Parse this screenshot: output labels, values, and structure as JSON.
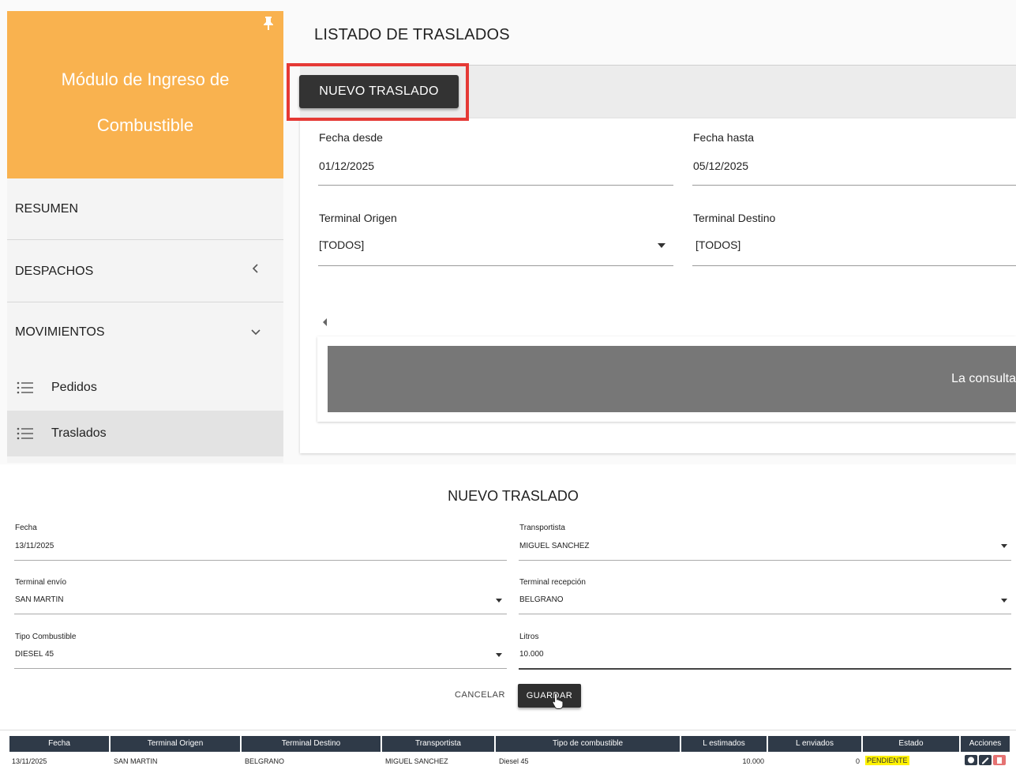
{
  "sidebar": {
    "app_title": "Módulo de Ingreso de Combustible",
    "items": [
      {
        "label": "RESUMEN"
      },
      {
        "label": "DESPACHOS"
      },
      {
        "label": "MOVIMIENTOS"
      }
    ],
    "sub_items": [
      {
        "label": "Pedidos"
      },
      {
        "label": "Traslados"
      }
    ]
  },
  "list": {
    "title": "LISTADO DE TRASLADOS",
    "new_button": "NUEVO TRASLADO",
    "filters": {
      "date_from_label": "Fecha desde",
      "date_from_value": "01/12/2025",
      "date_to_label": "Fecha hasta",
      "date_to_value": "05/12/2025",
      "origin_label": "Terminal Origen",
      "origin_value": "[TODOS]",
      "destination_label": "Terminal Destino",
      "destination_value": "[TODOS]"
    },
    "result_message": "La consulta"
  },
  "form": {
    "title": "NUEVO TRASLADO",
    "fields": {
      "date_label": "Fecha",
      "date_value": "13/11/2025",
      "carrier_label": "Transportista",
      "carrier_value": "MIGUEL SANCHEZ",
      "send_terminal_label": "Terminal envío",
      "send_terminal_value": "SAN MARTIN",
      "receive_terminal_label": "Terminal recepción",
      "receive_terminal_value": "BELGRANO",
      "fuel_type_label": "Tipo Combustible",
      "fuel_type_value": "DIESEL 45",
      "liters_label": "Litros",
      "liters_value": "10.000"
    },
    "cancel_label": "CANCELAR",
    "save_label": "GUARDAR"
  },
  "table": {
    "headers": [
      "Fecha",
      "Terminal Origen",
      "Terminal Destino",
      "Transportista",
      "Tipo de combustible",
      "L estimados",
      "L enviados",
      "Estado",
      "Acciones"
    ],
    "rows": [
      {
        "fecha": "13/11/2025",
        "origen": "SAN MARTIN",
        "destino": "BELGRANO",
        "transportista": "MIGUEL SANCHEZ",
        "combustible": "Diesel 45",
        "estimados": "10.000",
        "enviados": "0",
        "estado": "PENDIENTE"
      }
    ]
  },
  "colors": {
    "brand": "#f9b24f",
    "highlight": "#e53935",
    "status_pending": "#fff200",
    "table_header": "#2f3a48"
  },
  "icons": [
    "pin-icon",
    "chevron-left-icon",
    "chevron-down-icon",
    "list-icon",
    "dropdown-arrow-icon",
    "cursor-icon",
    "view-icon",
    "edit-icon",
    "delete-icon"
  ]
}
